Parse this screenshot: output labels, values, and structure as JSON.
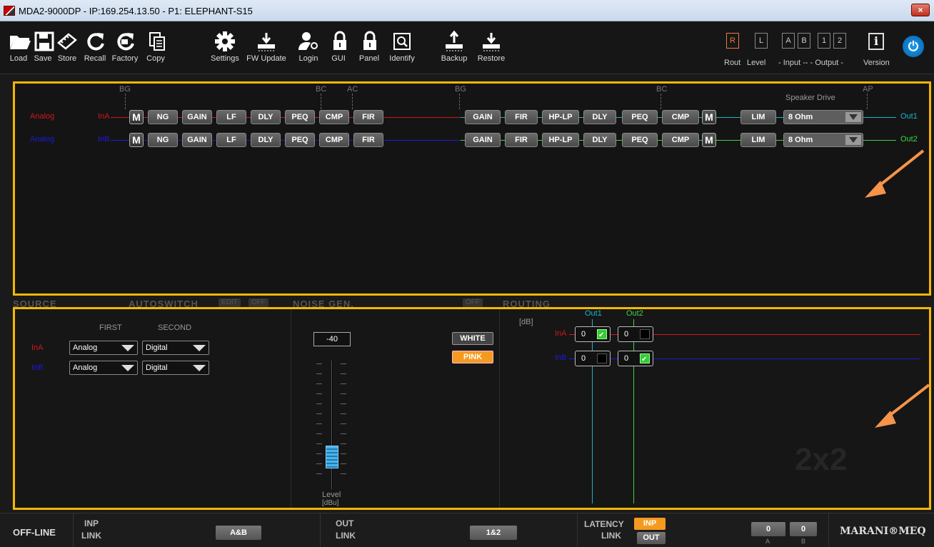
{
  "window": {
    "title": "MDA2-9000DP - IP:169.254.13.50 - P1: ELEPHANT-S15",
    "close": "×"
  },
  "toolbar": {
    "buttons": [
      {
        "label": "Load",
        "icon": "folder-icon"
      },
      {
        "label": "Save",
        "icon": "floppy-icon"
      },
      {
        "label": "Store",
        "icon": "chip-icon"
      },
      {
        "label": "Recall",
        "icon": "refresh-icon"
      },
      {
        "label": "Factory",
        "icon": "factory-reset-icon"
      },
      {
        "label": "Copy",
        "icon": "copy-icon"
      },
      {
        "label": "Settings",
        "icon": "gear-icon"
      },
      {
        "label": "FW Update",
        "icon": "firmware-update-icon"
      },
      {
        "label": "Login",
        "icon": "user-key-icon"
      },
      {
        "label": "GUI",
        "icon": "lock-icon"
      },
      {
        "label": "Panel",
        "icon": "lock-icon"
      },
      {
        "label": "Identify",
        "icon": "identify-icon"
      },
      {
        "label": "Backup",
        "icon": "backup-icon"
      },
      {
        "label": "Restore",
        "icon": "restore-icon"
      }
    ],
    "view_toggles": {
      "r": "R",
      "l": "L",
      "a": "A",
      "b": "B",
      "one": "1",
      "two": "2",
      "rout_label": "Rout",
      "level_label": "Level",
      "input_label": "- Input -- - Output -"
    },
    "version_label": "Version",
    "version_glyph": "i"
  },
  "chain": {
    "markers": [
      "BG",
      "BC",
      "AC",
      "BG",
      "BC",
      "AP"
    ],
    "speaker_drive_label": "Speaker Drive",
    "rows": [
      {
        "source": "Analog",
        "input": "InA",
        "color": "#d01818",
        "out_color": "#19b6c8",
        "output": "Out1",
        "drive": "8 Ohm"
      },
      {
        "source": "Analog",
        "input": "InB",
        "color": "#1a1adc",
        "out_color": "#3ed63e",
        "output": "Out2",
        "drive": "8 Ohm"
      }
    ],
    "input_blocks": [
      "NG",
      "GAIN",
      "LF",
      "DLY",
      "PEQ",
      "CMP",
      "FIR"
    ],
    "output_blocks": [
      "GAIN",
      "FIR",
      "HP-LP",
      "DLY",
      "PEQ",
      "CMP"
    ],
    "mute": "M",
    "lim": "LIM"
  },
  "lower": {
    "headers": {
      "source": "SOURCE",
      "autoswitch": "AUTOSWITCH",
      "edit": "EDIT",
      "off": "OFF",
      "noise_gen": "NOISE GEN.",
      "noise_off": "OFF",
      "routing": "ROUTING"
    },
    "source": {
      "first_label": "FIRST",
      "second_label": "SECOND",
      "rows": [
        {
          "input": "InA",
          "first": "Analog",
          "second": "Digital"
        },
        {
          "input": "InB",
          "first": "Analog",
          "second": "Digital"
        }
      ]
    },
    "noise": {
      "level_value": "-40",
      "level_label": "Level",
      "level_unit": "[dBu]",
      "white": "WHITE",
      "pink": "PINK",
      "fader_level": 0.25
    },
    "routing": {
      "unit": "[dB]",
      "out1": "Out1",
      "out2": "Out2",
      "rows": [
        {
          "input": "InA",
          "cells": [
            {
              "value": "0",
              "on": true
            },
            {
              "value": "0",
              "on": false
            }
          ]
        },
        {
          "input": "InB",
          "cells": [
            {
              "value": "0",
              "on": false
            },
            {
              "value": "0",
              "on": true
            }
          ]
        }
      ],
      "matrix_label": "2x2"
    }
  },
  "status": {
    "state": "OFF-LINE",
    "inp_link_label_1": "INP",
    "inp_link_label_2": "LINK",
    "inp_link_value": "A&B",
    "out_link_label_1": "OUT",
    "out_link_label_2": "LINK",
    "out_link_value": "1&2",
    "latency_label_1": "LATENCY",
    "latency_label_2": "LINK",
    "latency_inp": "INP",
    "latency_out": "OUT",
    "meter_a": "0",
    "meter_b": "0",
    "meter_a_label": "A",
    "meter_b_label": "B",
    "brand": "MARANI®MEQ"
  },
  "colors": {
    "accent": "#f5b800",
    "pink_btn": "#f59a1e",
    "annotation": "#f5944a"
  }
}
